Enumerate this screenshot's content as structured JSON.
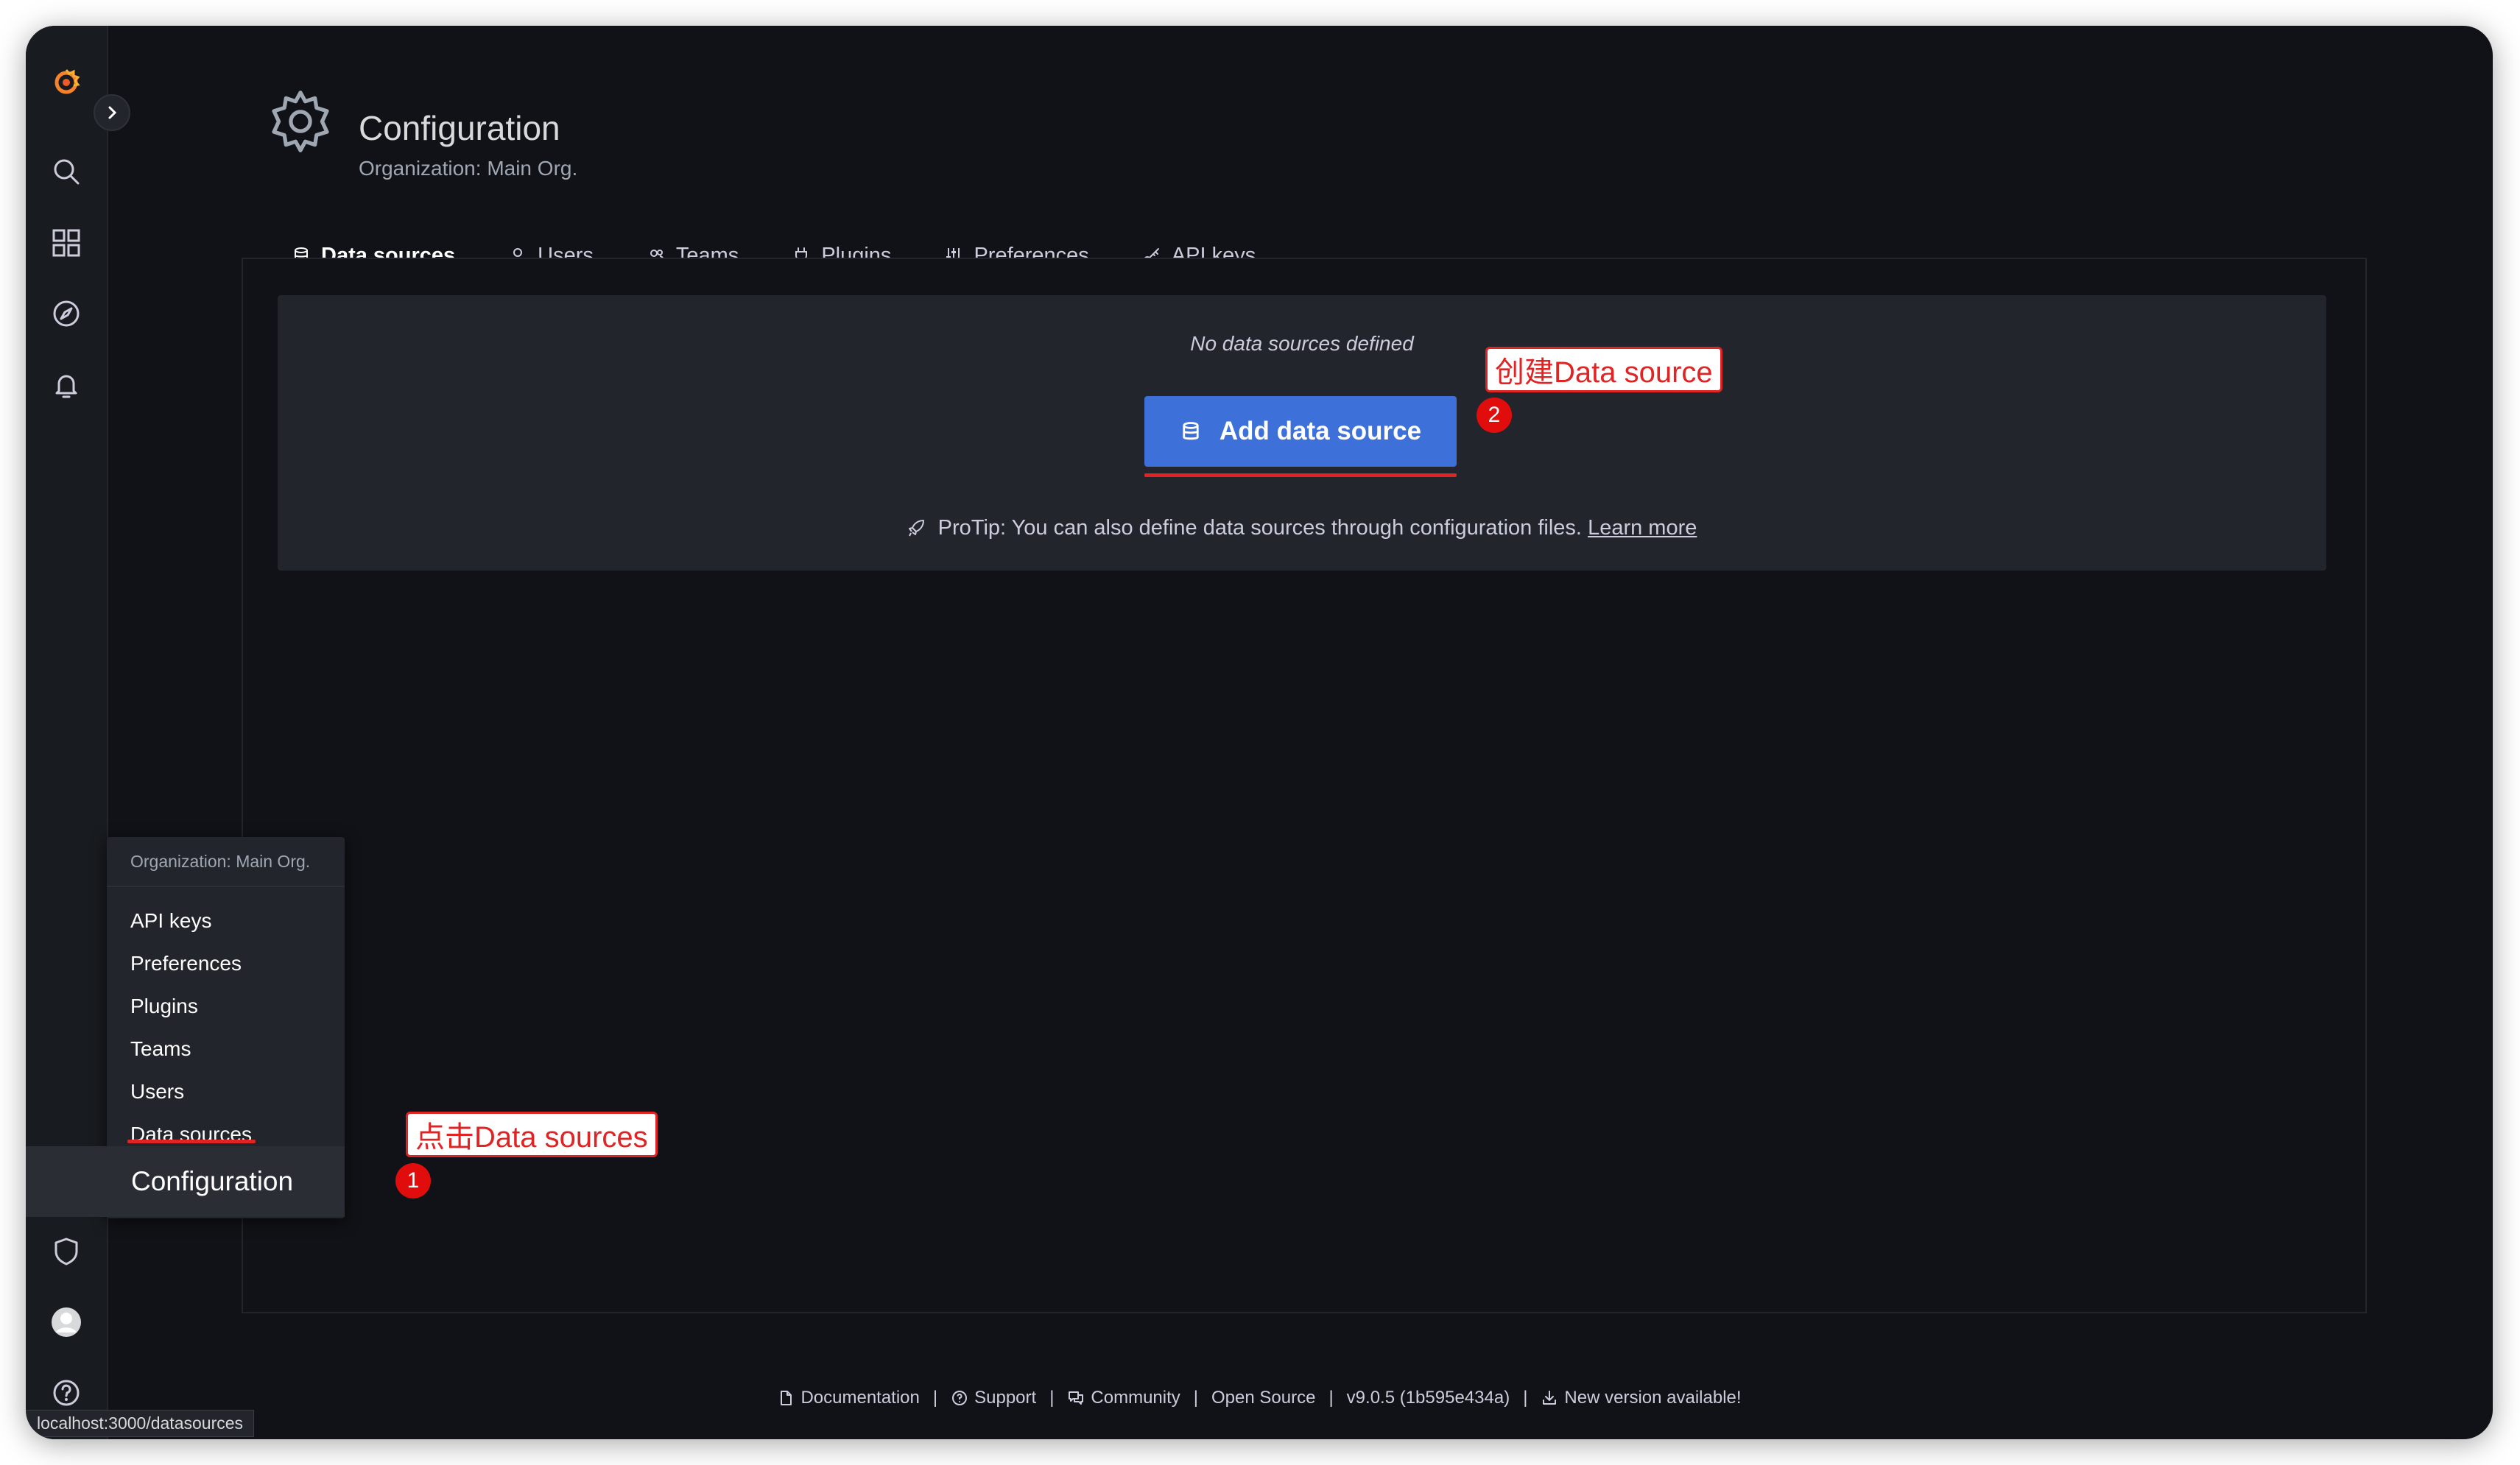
{
  "header": {
    "title": "Configuration",
    "subtitle": "Organization: Main Org."
  },
  "tabs": [
    {
      "label": "Data sources",
      "icon": "database-icon",
      "active": true
    },
    {
      "label": "Users",
      "icon": "user-icon"
    },
    {
      "label": "Teams",
      "icon": "users-icon"
    },
    {
      "label": "Plugins",
      "icon": "plug-icon"
    },
    {
      "label": "Preferences",
      "icon": "sliders-icon"
    },
    {
      "label": "API keys",
      "icon": "key-icon"
    }
  ],
  "empty_state": {
    "message": "No data sources defined",
    "button_label": "Add data source",
    "protip": "ProTip: You can also define data sources through configuration files.",
    "learn_more": "Learn more"
  },
  "annotations": {
    "callout_create": "创建Data source",
    "callout_click": "点击Data sources",
    "badge_1": "1",
    "badge_2": "2"
  },
  "config_menu": {
    "header": "Organization: Main Org.",
    "items": [
      "API keys",
      "Preferences",
      "Plugins",
      "Teams",
      "Users",
      "Data sources"
    ],
    "footer": "Configuration"
  },
  "footer": {
    "documentation": "Documentation",
    "support": "Support",
    "community": "Community",
    "open_source": "Open Source",
    "version": "v9.0.5 (1b595e434a)",
    "new_version": "New version available!"
  },
  "status_url": "localhost:3000/datasources",
  "colors": {
    "accent": "#f55f3e",
    "primary_button": "#3d71d9",
    "annotation_red": "#e02424"
  }
}
